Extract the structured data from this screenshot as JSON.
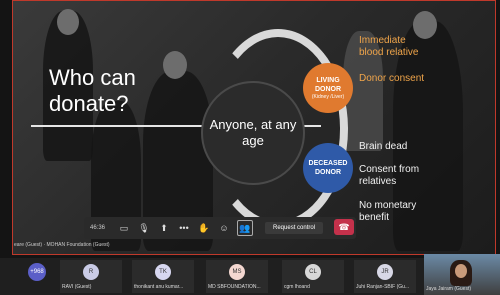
{
  "slide": {
    "title": "Who can donate?",
    "center": "Anyone, at any age",
    "living_badge": {
      "title": "LIVING DONOR",
      "sub": "(Kidney /Liver)"
    },
    "deceased_badge": {
      "title": "DECEASED DONOR"
    },
    "living_points": [
      "Immediate blood relative",
      "Donor consent"
    ],
    "deceased_points": [
      "Brain dead",
      "Consent from relatives",
      "No monetary benefit"
    ],
    "colors": {
      "orange": "#e07a2f",
      "blue": "#2f5aa8",
      "accent_text": "#f0a54a"
    }
  },
  "controls": {
    "timer": "46:36",
    "request_label": "Request control",
    "icons": [
      "camera-off-icon",
      "mic-off-icon",
      "share-icon",
      "more-icon",
      "raise-hand-icon",
      "reactions-icon",
      "people-icon",
      "hangup-icon"
    ]
  },
  "presenter_label": "eare (Guest) · MOHAN Foundation (Guest)",
  "participants": {
    "more_count": "+968",
    "people": [
      {
        "initials": "R",
        "name": "RAVI (Guest)",
        "color": "#c9cbe6"
      },
      {
        "initials": "TK",
        "name": "thonikant anu kumar...",
        "color": "#d7d7f0"
      },
      {
        "initials": "MS",
        "name": "MD SBFOUNDATION...",
        "color": "#f3d7d0"
      },
      {
        "initials": "CL",
        "name": "cgm lhoand",
        "color": "#d8d8d8"
      },
      {
        "initials": "JR",
        "name": "Juhi Ranjan-SBIF (Gu...",
        "color": "#d8d8e6"
      }
    ],
    "video_name": "Jaya Jairam (Guest)"
  }
}
